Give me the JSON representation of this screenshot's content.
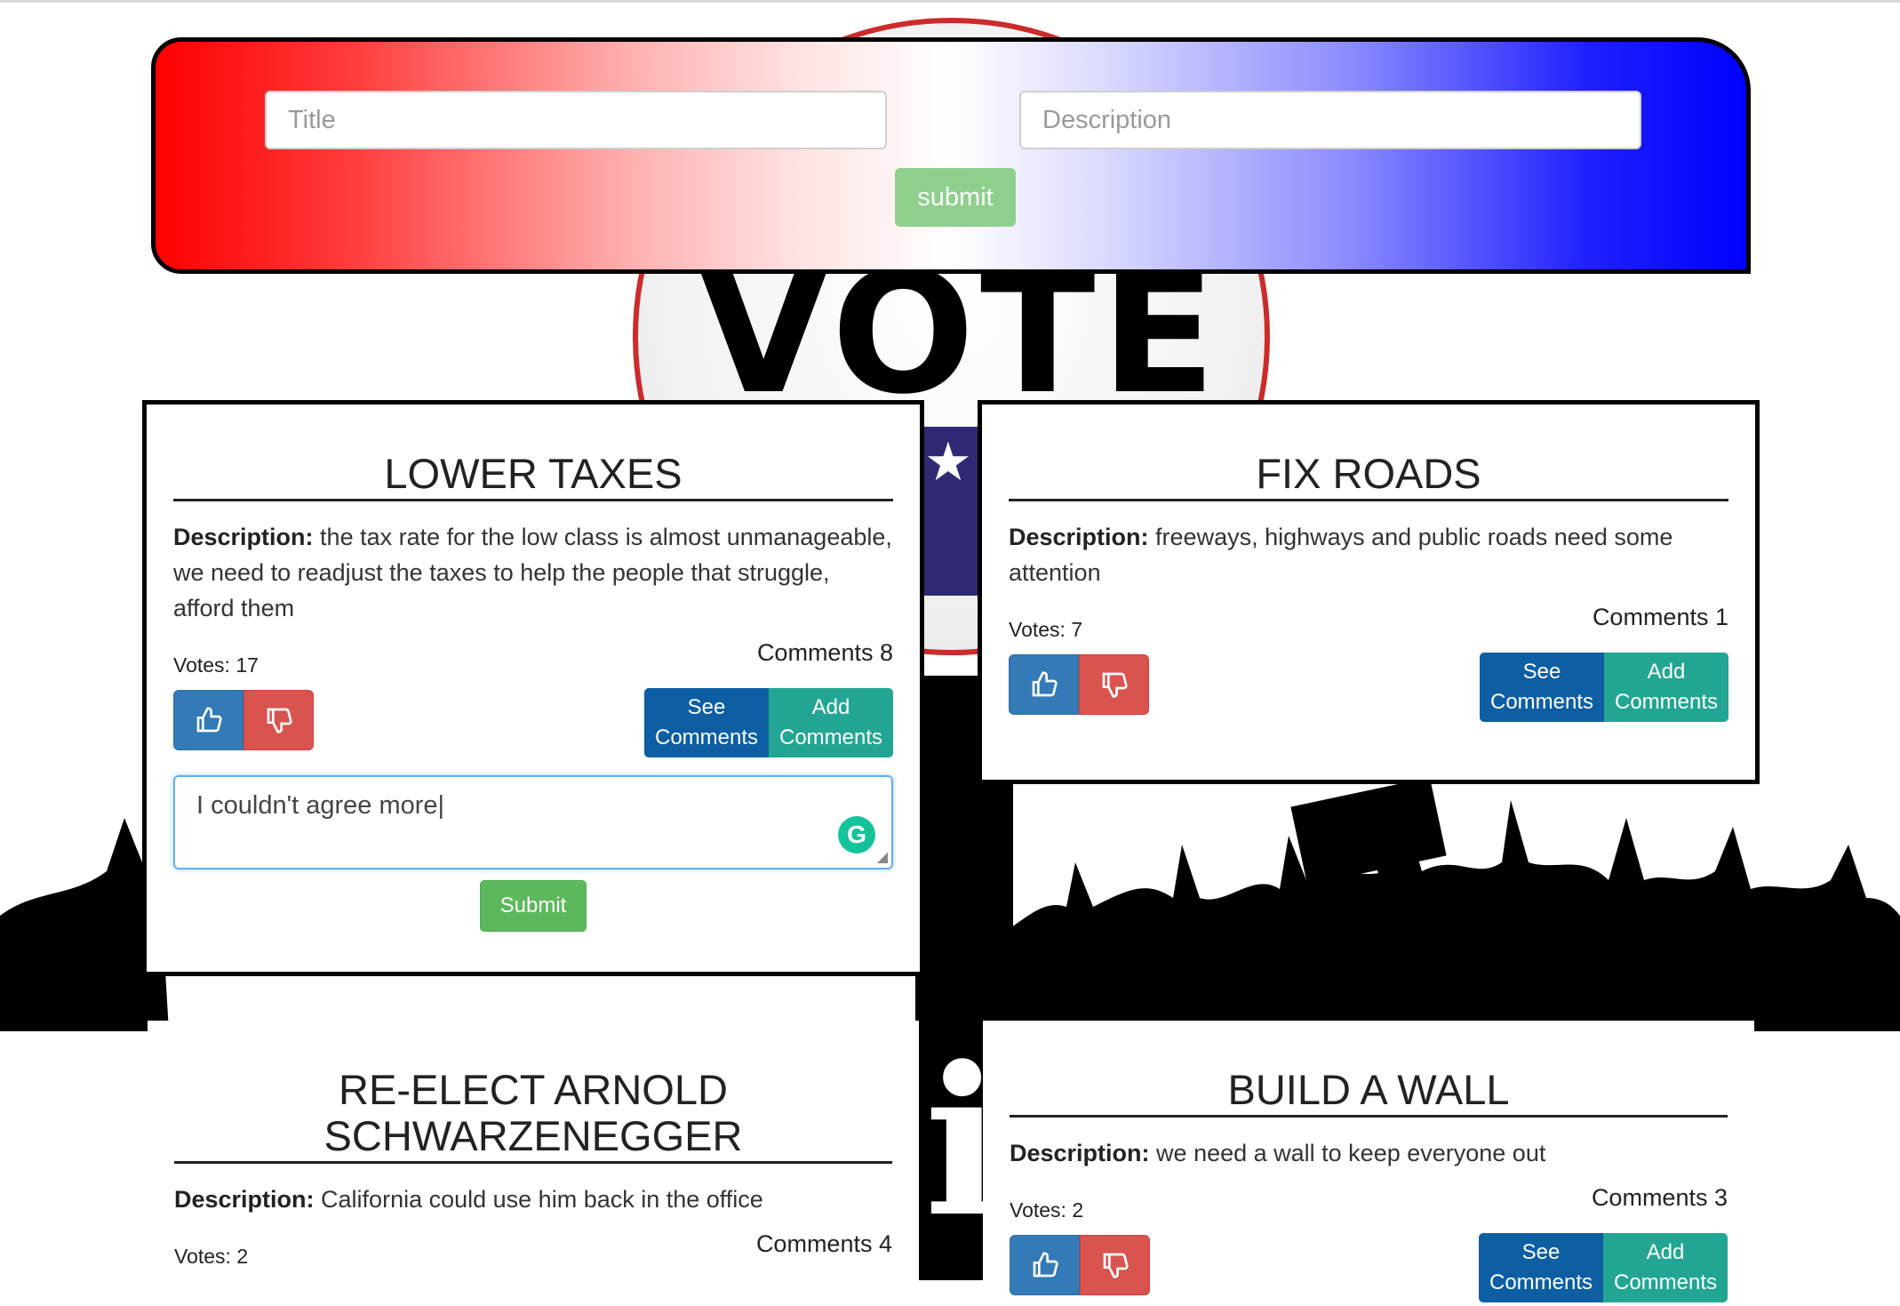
{
  "form": {
    "title_placeholder": "Title",
    "description_placeholder": "Description",
    "submit_label": "submit"
  },
  "background": {
    "badge_text": "VOTE"
  },
  "labels": {
    "description": "Description:",
    "votes_prefix": "Votes:",
    "comments_prefix": "Comments",
    "see_comments": "See Comments",
    "add_comments": "Add Comments",
    "comment_submit": "Submit"
  },
  "cards": [
    {
      "title": "LOWER TAXES",
      "description": "the tax rate for the low class is almost unmanageable, we need to readjust the taxes to help the people that struggle, afford them",
      "votes": "Votes: 17",
      "comments": "Comments 8",
      "comment_input": "I couldn't agree more"
    },
    {
      "title": "FIX ROADS",
      "description": "freeways, highways and public roads need some attention",
      "votes": "Votes: 7",
      "comments": "Comments 1"
    },
    {
      "title": "RE-ELECT ARNOLD SCHWARZENEGGER",
      "description": "California could use him back in the office",
      "votes": "Votes: 2",
      "comments": "Comments 4"
    },
    {
      "title": "BUILD A WALL",
      "description": "we need a wall to keep everyone out",
      "votes": "Votes: 2",
      "comments": "Comments 3"
    }
  ],
  "icons": {
    "upvote": "thumbs-up-icon",
    "downvote": "thumbs-down-icon",
    "grammarly": "grammarly-icon"
  },
  "colors": {
    "upvote": "#337ab7",
    "downvote": "#d9534f",
    "see_comments": "#0d5ea3",
    "add_comments": "#22a693",
    "submit": "#5cb85c"
  }
}
